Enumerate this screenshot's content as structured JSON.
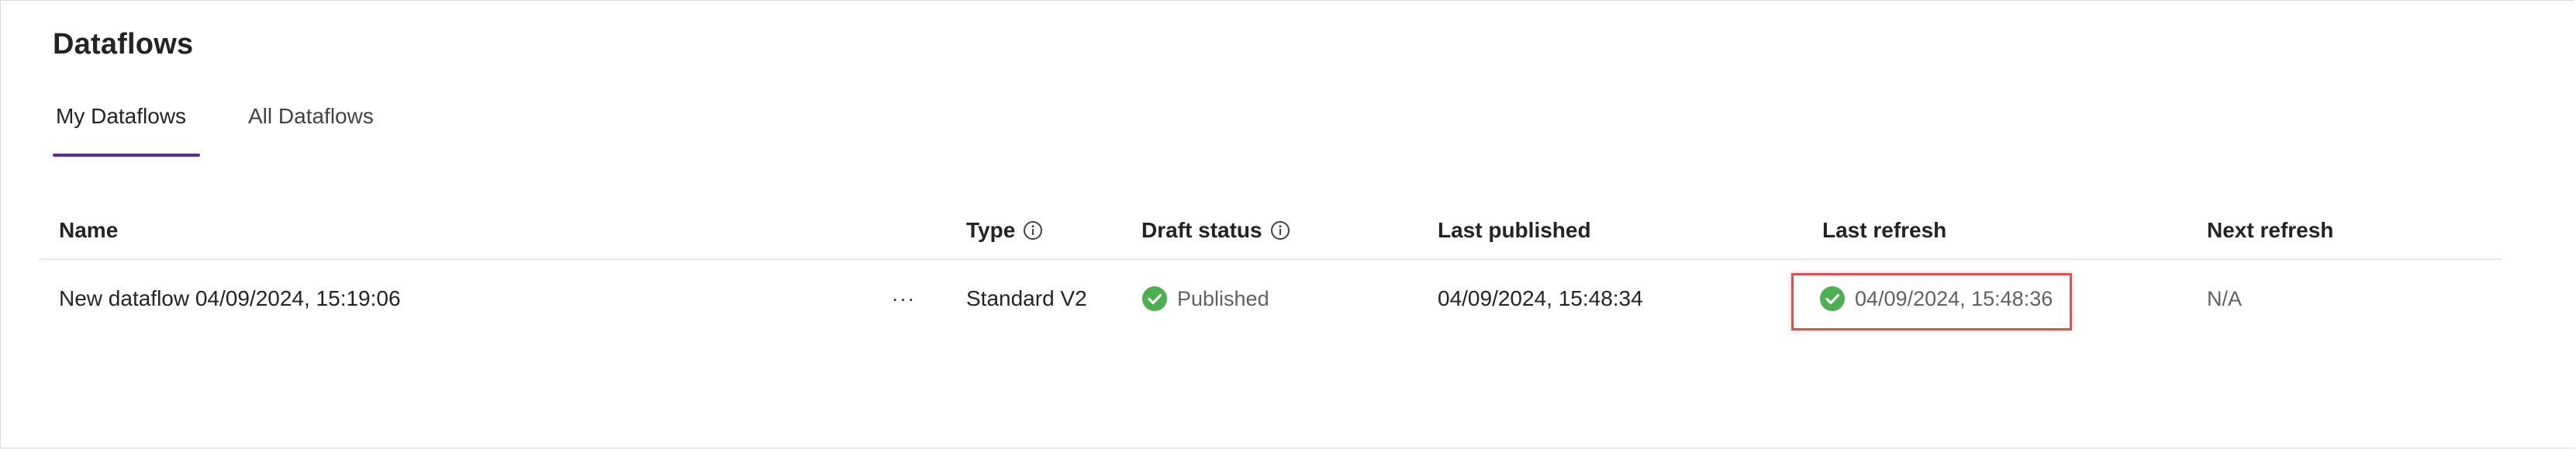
{
  "page": {
    "title": "Dataflows"
  },
  "tabs": [
    {
      "label": "My Dataflows",
      "active": true
    },
    {
      "label": "All Dataflows",
      "active": false
    }
  ],
  "table": {
    "columns": {
      "name": "Name",
      "type": "Type",
      "draft_status": "Draft status",
      "last_published": "Last published",
      "last_refresh": "Last refresh",
      "next_refresh": "Next refresh"
    },
    "rows": [
      {
        "name": "New dataflow 04/09/2024, 15:19:06",
        "more": "···",
        "type": "Standard V2",
        "draft_status": "Published",
        "last_published": "04/09/2024, 15:48:34",
        "last_refresh": "04/09/2024, 15:48:36",
        "next_refresh": "N/A"
      }
    ]
  },
  "icons": {
    "info": "info-icon",
    "success": "check-circle-icon",
    "more": "more-icon"
  },
  "colors": {
    "accent": "#5c2e91",
    "success": "#4caf50",
    "highlight": "#d9534f"
  }
}
